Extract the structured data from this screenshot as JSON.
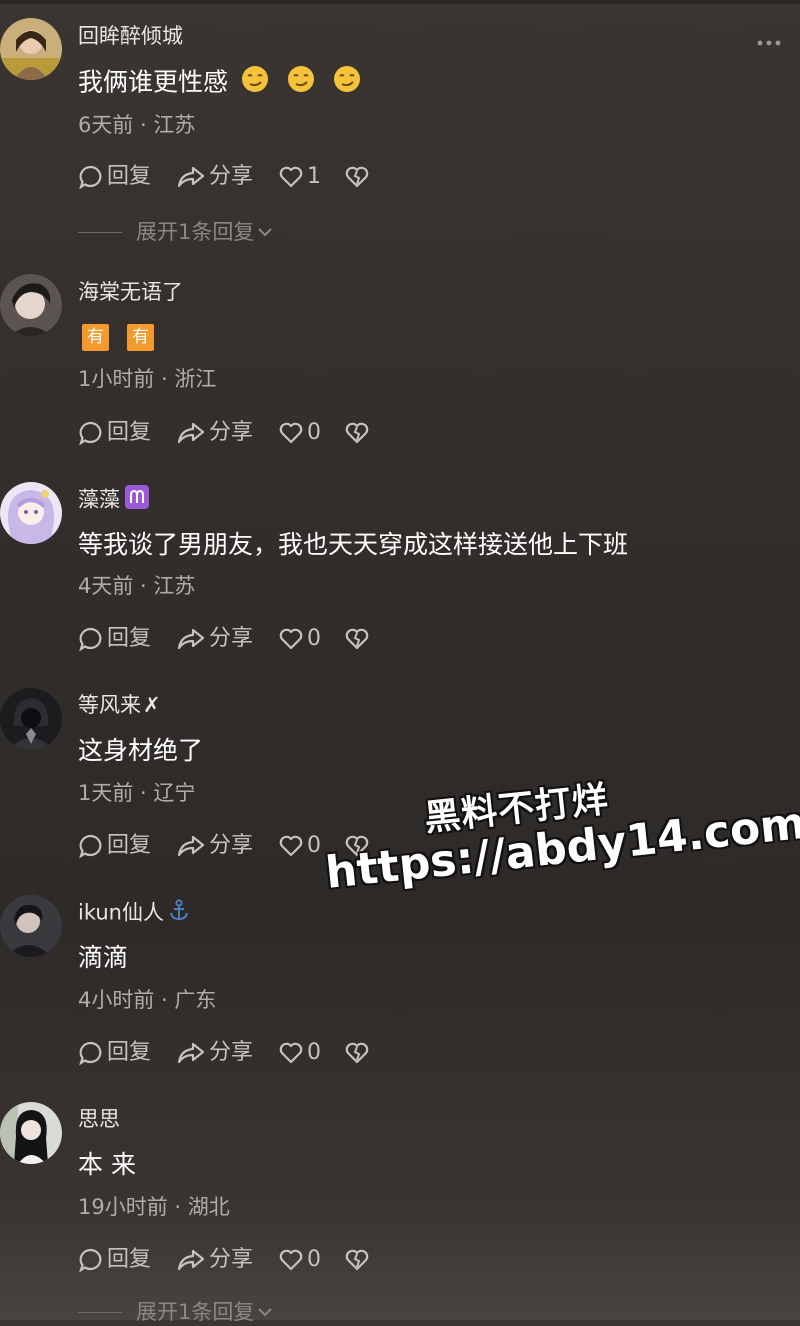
{
  "comments": [
    {
      "username": "回眸醉倾城",
      "content": "我俩谁更性感",
      "emojis": [
        "smirk-emoji",
        "smirk-emoji",
        "smirk-emoji"
      ],
      "meta": "6天前 · 江苏",
      "reply_label": "回复",
      "share_label": "分享",
      "like_count": "1",
      "expand_label": "展开1条回复"
    },
    {
      "username": "海棠无语了",
      "content_tags": [
        "有",
        "有"
      ],
      "meta": "1小时前 · 浙江",
      "reply_label": "回复",
      "share_label": "分享",
      "like_count": "0"
    },
    {
      "username": "藻藻",
      "badge": "♈",
      "content": "等我谈了男朋友，我也天天穿成这样接送他上下班",
      "meta": "4天前 · 江苏",
      "reply_label": "回复",
      "share_label": "分享",
      "like_count": "0"
    },
    {
      "username": "等风来",
      "badge": "✗",
      "content": "这身材绝了",
      "meta": "1天前 · 辽宁",
      "reply_label": "回复",
      "share_label": "分享",
      "like_count": "0"
    },
    {
      "username": "ikun仙人",
      "badge": "⚓",
      "content": "滴滴",
      "meta": "4小时前 · 广东",
      "reply_label": "回复",
      "share_label": "分享",
      "like_count": "0"
    },
    {
      "username": "思思",
      "content": "本 来",
      "meta": "19小时前 · 湖北",
      "reply_label": "回复",
      "share_label": "分享",
      "like_count": "0",
      "expand_label": "展开1条回复"
    }
  ],
  "watermark": {
    "title": "黑料不打烊",
    "url": "https://abdy14.com"
  },
  "colors": {
    "background": "#332e2b",
    "tag_orange": "#f29a2e",
    "meta_text": "#b2aca7",
    "badge_purple": "#9b59d9",
    "badge_blue": "#4a7fc1"
  }
}
